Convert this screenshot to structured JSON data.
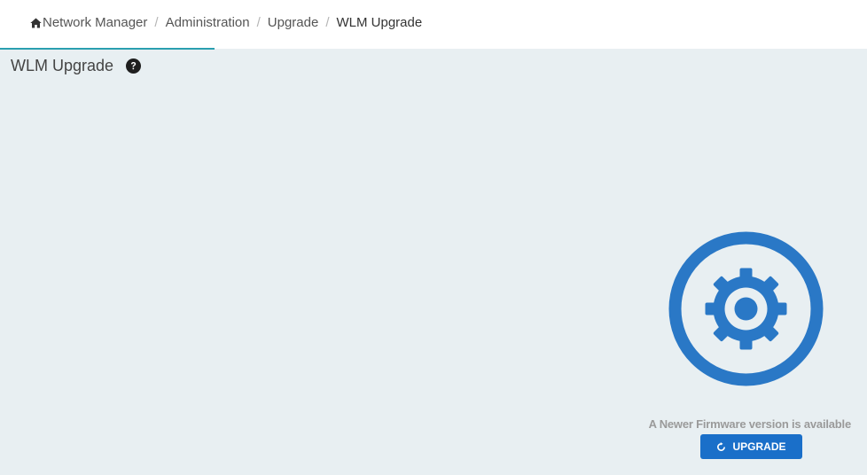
{
  "breadcrumb": {
    "items": [
      {
        "label": "Network Manager",
        "icon": "home-icon"
      },
      {
        "label": "Administration"
      },
      {
        "label": "Upgrade"
      }
    ],
    "current": "WLM Upgrade",
    "separator": "/"
  },
  "page": {
    "title": "WLM Upgrade",
    "help_icon": "question-circle-icon"
  },
  "upgrade": {
    "illustration_icon": "gear-icon",
    "status_text": "A Newer Firmware version is available",
    "button_label": "UPGRADE",
    "button_icon": "refresh-icon"
  },
  "colors": {
    "accent": "#1a6fc9",
    "gear": "#2a78c6",
    "background": "#e8eff2",
    "tab_underline": "#2a9fb0"
  }
}
